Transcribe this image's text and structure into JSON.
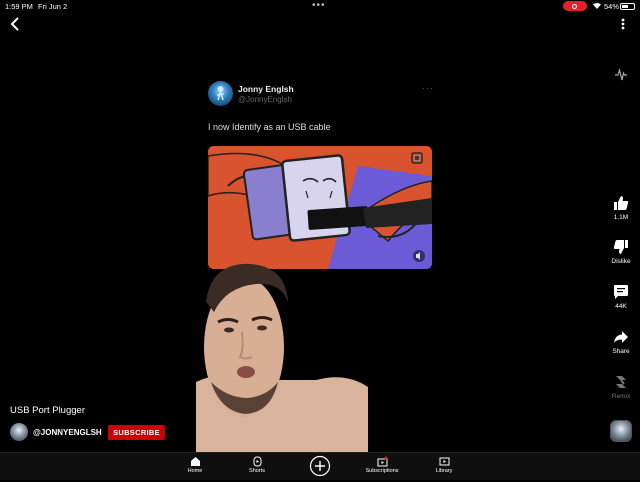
{
  "status_bar": {
    "time": "1:59 PM",
    "date": "Fri Jun 2",
    "battery": "54%",
    "battery_level": 0.54
  },
  "tweet": {
    "display_name": "Jonny Englsh",
    "handle": "@JonnyEnglsh",
    "text": "I now Identify as an USB cable"
  },
  "video": {
    "title": "USB Port Plugger",
    "channel": "@JONNYENGLSH",
    "subscribe_label": "SUBSCRIBE"
  },
  "actions": {
    "like_count": "1.1M",
    "dislike_label": "Dislike",
    "comments_count": "44K",
    "share_label": "Share",
    "remix_label": "Remix"
  },
  "nav": {
    "home": "Home",
    "shorts": "Shorts",
    "subscriptions": "Subscriptions",
    "library": "Library"
  },
  "colors": {
    "background": "#000000",
    "subscribe": "#cc0000",
    "record_indicator": "#e0232a"
  }
}
